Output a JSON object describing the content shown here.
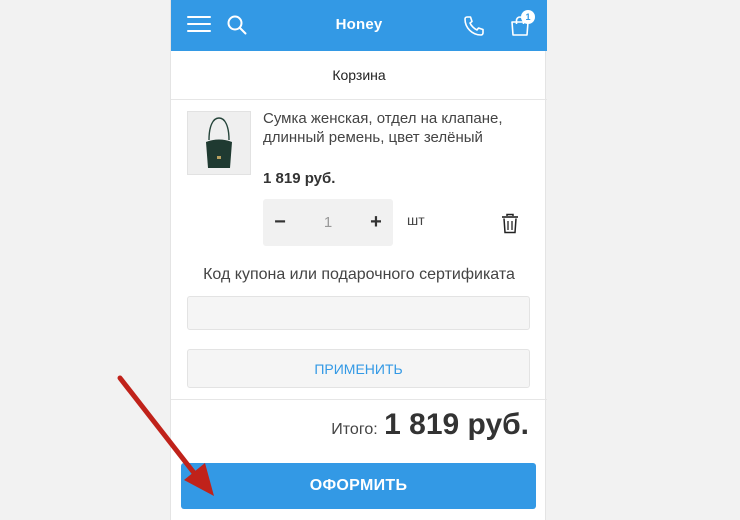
{
  "header": {
    "brand": "Honey",
    "cart_count": "1",
    "icons": [
      "menu-icon",
      "search-icon",
      "phone-icon",
      "cart-icon"
    ],
    "background_color": "#3399e5"
  },
  "page": {
    "title": "Корзина"
  },
  "cart_item": {
    "name": "Сумка женская, отдел на клапане, длинный ремень, цвет зелёный",
    "price": "1 819 руб.",
    "quantity": "1",
    "unit": "шт",
    "decrement_label": "−",
    "increment_label": "+"
  },
  "coupon": {
    "label": "Код купона или подарочного сертификата",
    "value": "",
    "apply_label": "ПРИМЕНИТЬ"
  },
  "summary": {
    "total_label": "Итого:",
    "total_value": "1 819 руб."
  },
  "checkout": {
    "label": "ОФОРМИТЬ"
  },
  "annotation": {
    "color": "#c0221a",
    "icon": "red-arrow"
  }
}
